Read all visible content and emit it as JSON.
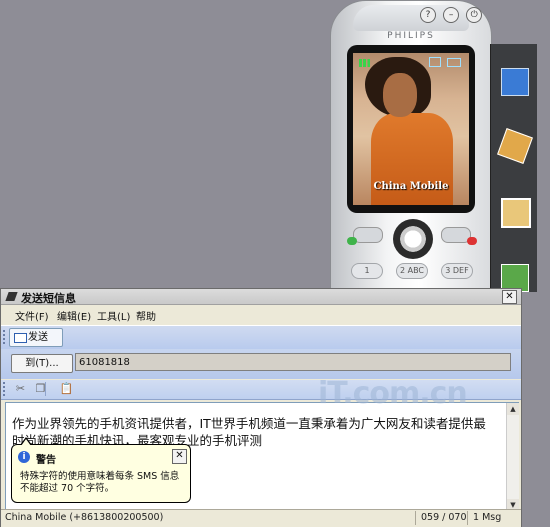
{
  "phone": {
    "brand": "PHILIPS",
    "operator": "China Mobile",
    "keys": [
      "1",
      "2 ABC",
      "3 DEF"
    ]
  },
  "window": {
    "title": "发送短信息",
    "menu": [
      "文件(F)",
      "编辑(E)",
      "工具(L)",
      "帮助"
    ],
    "send_label": "发送",
    "to_button": "到(T)...",
    "to_value": "61081818",
    "message": "作为业界领先的手机资讯提供者，IT世界手机频道一直秉承着为广大网友和读者提供最时尚新潮的手机快讯，最客观专业的手机评测",
    "tooltip": {
      "title": "警告",
      "body": "特殊字符的使用意味着每条 SMS 信息不能超过 70 个字符。"
    },
    "status": {
      "sender": "China Mobile (+8613800200500)",
      "count": "059 / 070",
      "msg": "1 Msg"
    }
  },
  "watermark": "iT.com.cn",
  "colors": {
    "background": "#8e8d96",
    "toolbar": "#c7d5ef",
    "tooltip": "#ffffe1"
  }
}
